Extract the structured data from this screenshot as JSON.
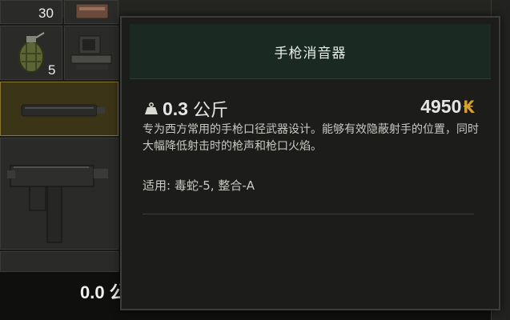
{
  "inventory": {
    "slots": [
      {
        "name": "ammo-box",
        "count": "30"
      },
      {
        "name": "frag-grenade",
        "count": "5"
      },
      {
        "name": "red-dot-sight",
        "count": ""
      },
      {
        "name": "pistol-silencer",
        "count": ""
      },
      {
        "name": "smg",
        "count": ""
      }
    ],
    "bottom_weight": "0.0 公"
  },
  "tooltip": {
    "title": "手枪消音器",
    "weight_value": "0.3",
    "weight_unit": "公斤",
    "price": "4950",
    "currency_icon": "₭",
    "description": "专为西方常用的手枪口径武器设计。能够有效隐蔽射手的位置，同时大幅降低射击时的枪声和枪口火焰。",
    "usage": "适用: 毒蛇-5, 整合-A"
  },
  "colors": {
    "header_bg": "#1a2a23",
    "selected_slot": "#3b3417",
    "currency": "#d7a230"
  }
}
